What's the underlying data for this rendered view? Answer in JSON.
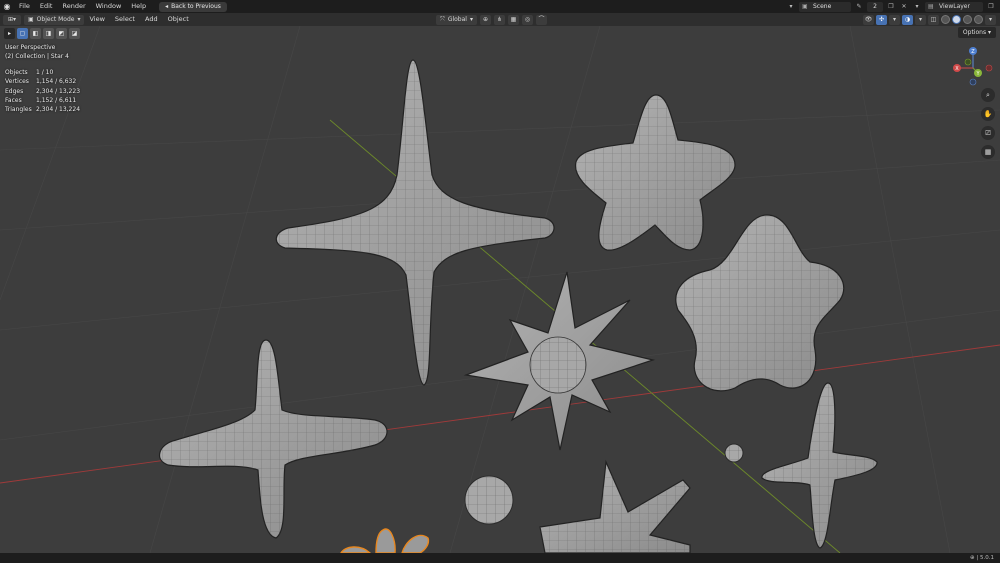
{
  "menubar": {
    "items": [
      "File",
      "Edit",
      "Render",
      "Window",
      "Help"
    ],
    "back_button": "Back to Previous",
    "scene": "Scene",
    "scene_number": "2",
    "view_layer": "ViewLayer"
  },
  "viewport_header": {
    "mode": "Object Mode",
    "menus": [
      "View",
      "Select",
      "Add",
      "Object"
    ],
    "transform_orientation": "Global"
  },
  "tool_options": {
    "options_label": "Options"
  },
  "overlay": {
    "view_name": "User Perspective",
    "collection": "(2) Collection | Star 4"
  },
  "stats": {
    "objects_label": "Objects",
    "objects_value": "1 / 10",
    "vertices_label": "Vertices",
    "vertices_value": "1,154 / 6,632",
    "edges_label": "Edges",
    "edges_value": "2,304 / 13,223",
    "faces_label": "Faces",
    "faces_value": "1,152 / 6,611",
    "triangles_label": "Triangles",
    "triangles_value": "2,304 / 13,224"
  },
  "gizmo": {
    "z": "Z",
    "y": "Y",
    "x": "X"
  },
  "statusbar": {
    "version": "5.0.1"
  },
  "colors": {
    "background": "#3d3d3d",
    "mesh": "#9a9a9a",
    "selected_outline": "#e8871e",
    "x_axis": "#a03a3a",
    "y_axis": "#6d8a2a",
    "active_tool": "#4772b3"
  }
}
